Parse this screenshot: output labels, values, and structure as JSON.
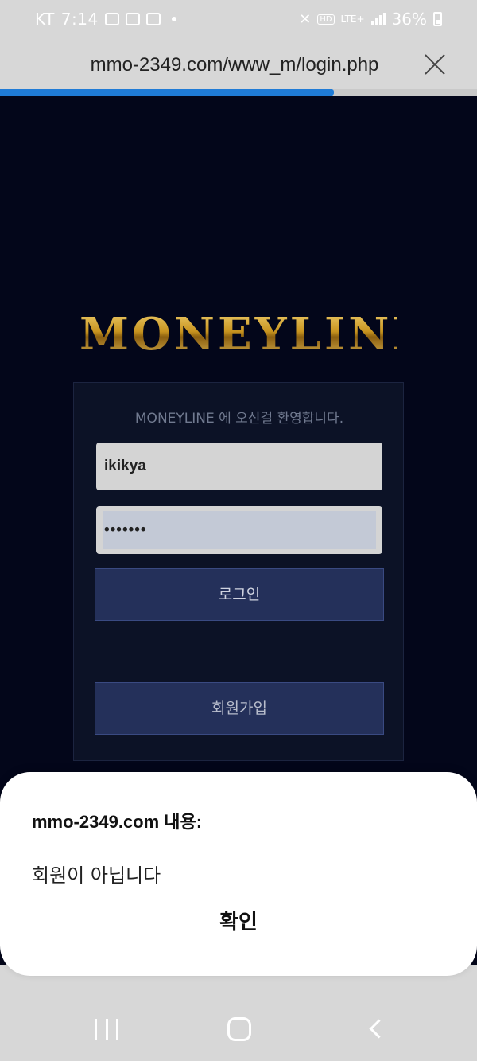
{
  "status_bar": {
    "carrier": "KT",
    "time": "7:14",
    "battery": "36%",
    "network": "LTE+",
    "hd": "HD",
    "icons": [
      "gallery-icon",
      "message-icon",
      "vpn-icon",
      "mute-icon",
      "signal-icon",
      "battery-icon"
    ]
  },
  "browser": {
    "url": "mmo-2349.com/www_m/login.php",
    "load_progress": 0.7,
    "progress_color": "#1f7bd6"
  },
  "page": {
    "logo": "MONEYLINE",
    "logo_color": "#d6a93a",
    "welcome": "MONEYLINE 에 오신걸 환영합니다.",
    "username_value": "ikikya",
    "password_value": "•••••••",
    "login_label": "로그인",
    "signup_label": "회원가입",
    "background_color": "#03061a"
  },
  "dialog": {
    "title": "mmo-2349.com 내용:",
    "message": "회원이 아닙니다",
    "ok_label": "확인"
  }
}
